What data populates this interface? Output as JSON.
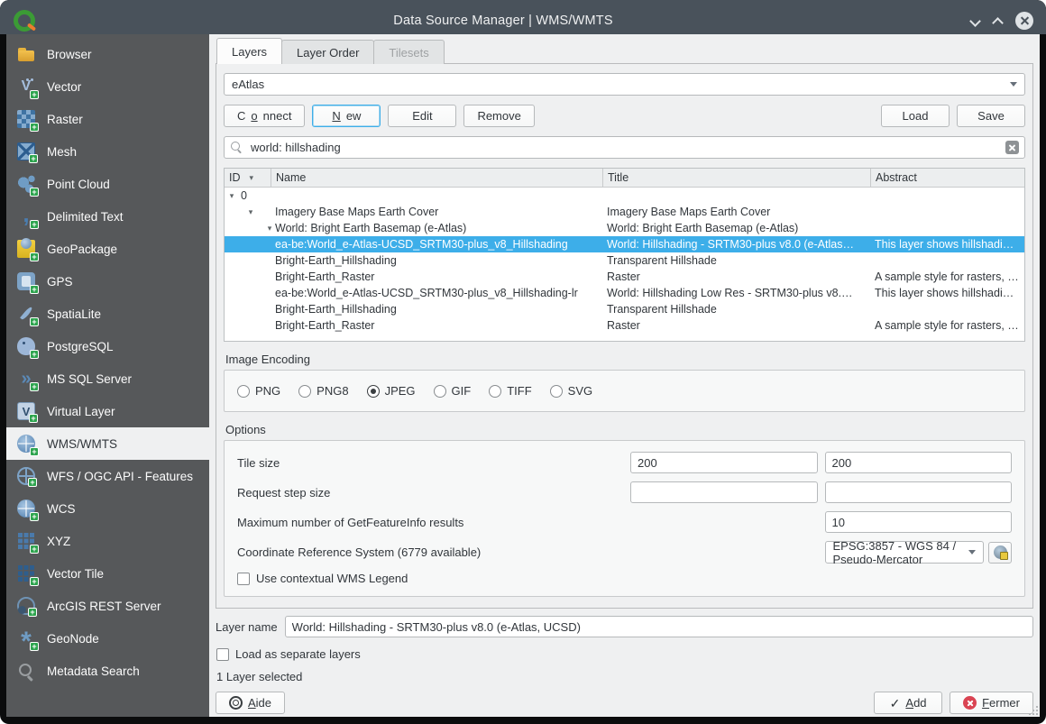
{
  "window": {
    "title": "Data Source Manager | WMS/WMTS"
  },
  "sidebar": {
    "items": [
      {
        "label": "Browser",
        "icon": "folder-icon",
        "badge": false,
        "selected": false
      },
      {
        "label": "Vector",
        "icon": "vector-icon",
        "badge": true,
        "selected": false
      },
      {
        "label": "Raster",
        "icon": "raster-icon",
        "badge": true,
        "selected": false
      },
      {
        "label": "Mesh",
        "icon": "mesh-icon",
        "badge": true,
        "selected": false
      },
      {
        "label": "Point Cloud",
        "icon": "point-cloud-icon",
        "badge": true,
        "selected": false
      },
      {
        "label": "Delimited Text",
        "icon": "delimited-text-icon",
        "badge": true,
        "selected": false
      },
      {
        "label": "GeoPackage",
        "icon": "geopackage-icon",
        "badge": true,
        "selected": false
      },
      {
        "label": "GPS",
        "icon": "gps-icon",
        "badge": true,
        "selected": false
      },
      {
        "label": "SpatiaLite",
        "icon": "spatialite-icon",
        "badge": true,
        "selected": false
      },
      {
        "label": "PostgreSQL",
        "icon": "postgresql-icon",
        "badge": true,
        "selected": false
      },
      {
        "label": "MS SQL Server",
        "icon": "mssql-icon",
        "badge": true,
        "selected": false
      },
      {
        "label": "Virtual Layer",
        "icon": "virtual-layer-icon",
        "badge": true,
        "selected": false
      },
      {
        "label": "WMS/WMTS",
        "icon": "wms-globe-icon",
        "badge": true,
        "selected": true
      },
      {
        "label": "WFS / OGC API - Features",
        "icon": "wfs-globe-icon",
        "badge": true,
        "selected": false
      },
      {
        "label": "WCS",
        "icon": "wcs-globe-icon",
        "badge": true,
        "selected": false
      },
      {
        "label": "XYZ",
        "icon": "xyz-grid-icon",
        "badge": true,
        "selected": false
      },
      {
        "label": "Vector Tile",
        "icon": "vector-tile-icon",
        "badge": true,
        "selected": false
      },
      {
        "label": "ArcGIS REST Server",
        "icon": "arcgis-globe-icon",
        "badge": true,
        "selected": false
      },
      {
        "label": "GeoNode",
        "icon": "geonode-icon",
        "badge": true,
        "selected": false
      },
      {
        "label": "Metadata Search",
        "icon": "metadata-search-icon",
        "badge": false,
        "selected": false
      }
    ]
  },
  "tabs": {
    "items": [
      {
        "label": "Layers",
        "state": "active"
      },
      {
        "label": "Layer Order",
        "state": "normal"
      },
      {
        "label": "Tilesets",
        "state": "disabled"
      }
    ]
  },
  "connection": {
    "value": "eAtlas",
    "connect": "Connect",
    "new": "New",
    "edit": "Edit",
    "remove": "Remove",
    "load": "Load",
    "save": "Save"
  },
  "search": {
    "value": "world: hillshading"
  },
  "table": {
    "columns": [
      "ID",
      "Name",
      "Title",
      "Abstract"
    ],
    "rows": [
      {
        "level": 0,
        "expander": true,
        "id": "0",
        "name": "",
        "title": "",
        "abstract": "",
        "selected": false
      },
      {
        "level": 1,
        "expander": true,
        "id": "",
        "name": "Imagery Base Maps Earth Cover",
        "title": "Imagery Base Maps Earth Cover",
        "abstract": "",
        "selected": false
      },
      {
        "level": 2,
        "expander": true,
        "id": "",
        "name": "World: Bright Earth Basemap (e-Atlas)",
        "title": "World: Bright Earth Basemap (e-Atlas)",
        "abstract": "",
        "selected": false
      },
      {
        "level": 3,
        "expander": false,
        "id": "",
        "name": "ea-be:World_e-Atlas-UCSD_SRTM30-plus_v8_Hillshading",
        "title": "World: Hillshading - SRTM30-plus v8.0 (e-Atlas…",
        "abstract": "This layer shows hillshadi…",
        "selected": true
      },
      {
        "level": 3,
        "expander": false,
        "id": "",
        "name": "Bright-Earth_Hillshading",
        "title": "Transparent Hillshade",
        "abstract": "",
        "selected": false
      },
      {
        "level": 3,
        "expander": false,
        "id": "",
        "name": "Bright-Earth_Raster",
        "title": "Raster",
        "abstract": "A sample style for rasters, …",
        "selected": false
      },
      {
        "level": 3,
        "expander": false,
        "id": "",
        "name": "ea-be:World_e-Atlas-UCSD_SRTM30-plus_v8_Hillshading-lr",
        "title": "World: Hillshading Low Res - SRTM30-plus v8.…",
        "abstract": "This layer shows hillshadi…",
        "selected": false
      },
      {
        "level": 3,
        "expander": false,
        "id": "",
        "name": "Bright-Earth_Hillshading",
        "title": "Transparent Hillshade",
        "abstract": "",
        "selected": false
      },
      {
        "level": 3,
        "expander": false,
        "id": "",
        "name": "Bright-Earth_Raster",
        "title": "Raster",
        "abstract": "A sample style for rasters, …",
        "selected": false
      }
    ]
  },
  "encoding": {
    "title": "Image Encoding",
    "options": [
      {
        "label": "PNG",
        "checked": false
      },
      {
        "label": "PNG8",
        "checked": false
      },
      {
        "label": "JPEG",
        "checked": true
      },
      {
        "label": "GIF",
        "checked": false
      },
      {
        "label": "TIFF",
        "checked": false
      },
      {
        "label": "SVG",
        "checked": false
      }
    ]
  },
  "options": {
    "title": "Options",
    "tile_size": {
      "label": "Tile size",
      "width": "200",
      "height": "200"
    },
    "request_step": {
      "label": "Request step size",
      "width": "",
      "height": ""
    },
    "feature_info": {
      "label": "Maximum number of GetFeatureInfo results",
      "value": "10"
    },
    "crs": {
      "label": "Coordinate Reference System (6779 available)",
      "value": "EPSG:3857 - WGS 84 / Pseudo-Mercator"
    },
    "legend": {
      "label": "Use contextual WMS Legend",
      "checked": false
    }
  },
  "footer": {
    "layer_name": {
      "label": "Layer name",
      "value": "World: Hillshading - SRTM30-plus v8.0 (e-Atlas, UCSD)"
    },
    "load_separate": {
      "label": "Load as separate layers",
      "checked": false
    },
    "status": "1 Layer selected",
    "help": "Aide",
    "add": "Add",
    "close": "Fermer"
  },
  "colors": {
    "titlebar": "#49525b",
    "sidebar": "#56585a",
    "selection": "#3daee9",
    "dialog_bg": "#eff0f1",
    "close_red": "#da4453",
    "plus_green": "#2da44e"
  }
}
